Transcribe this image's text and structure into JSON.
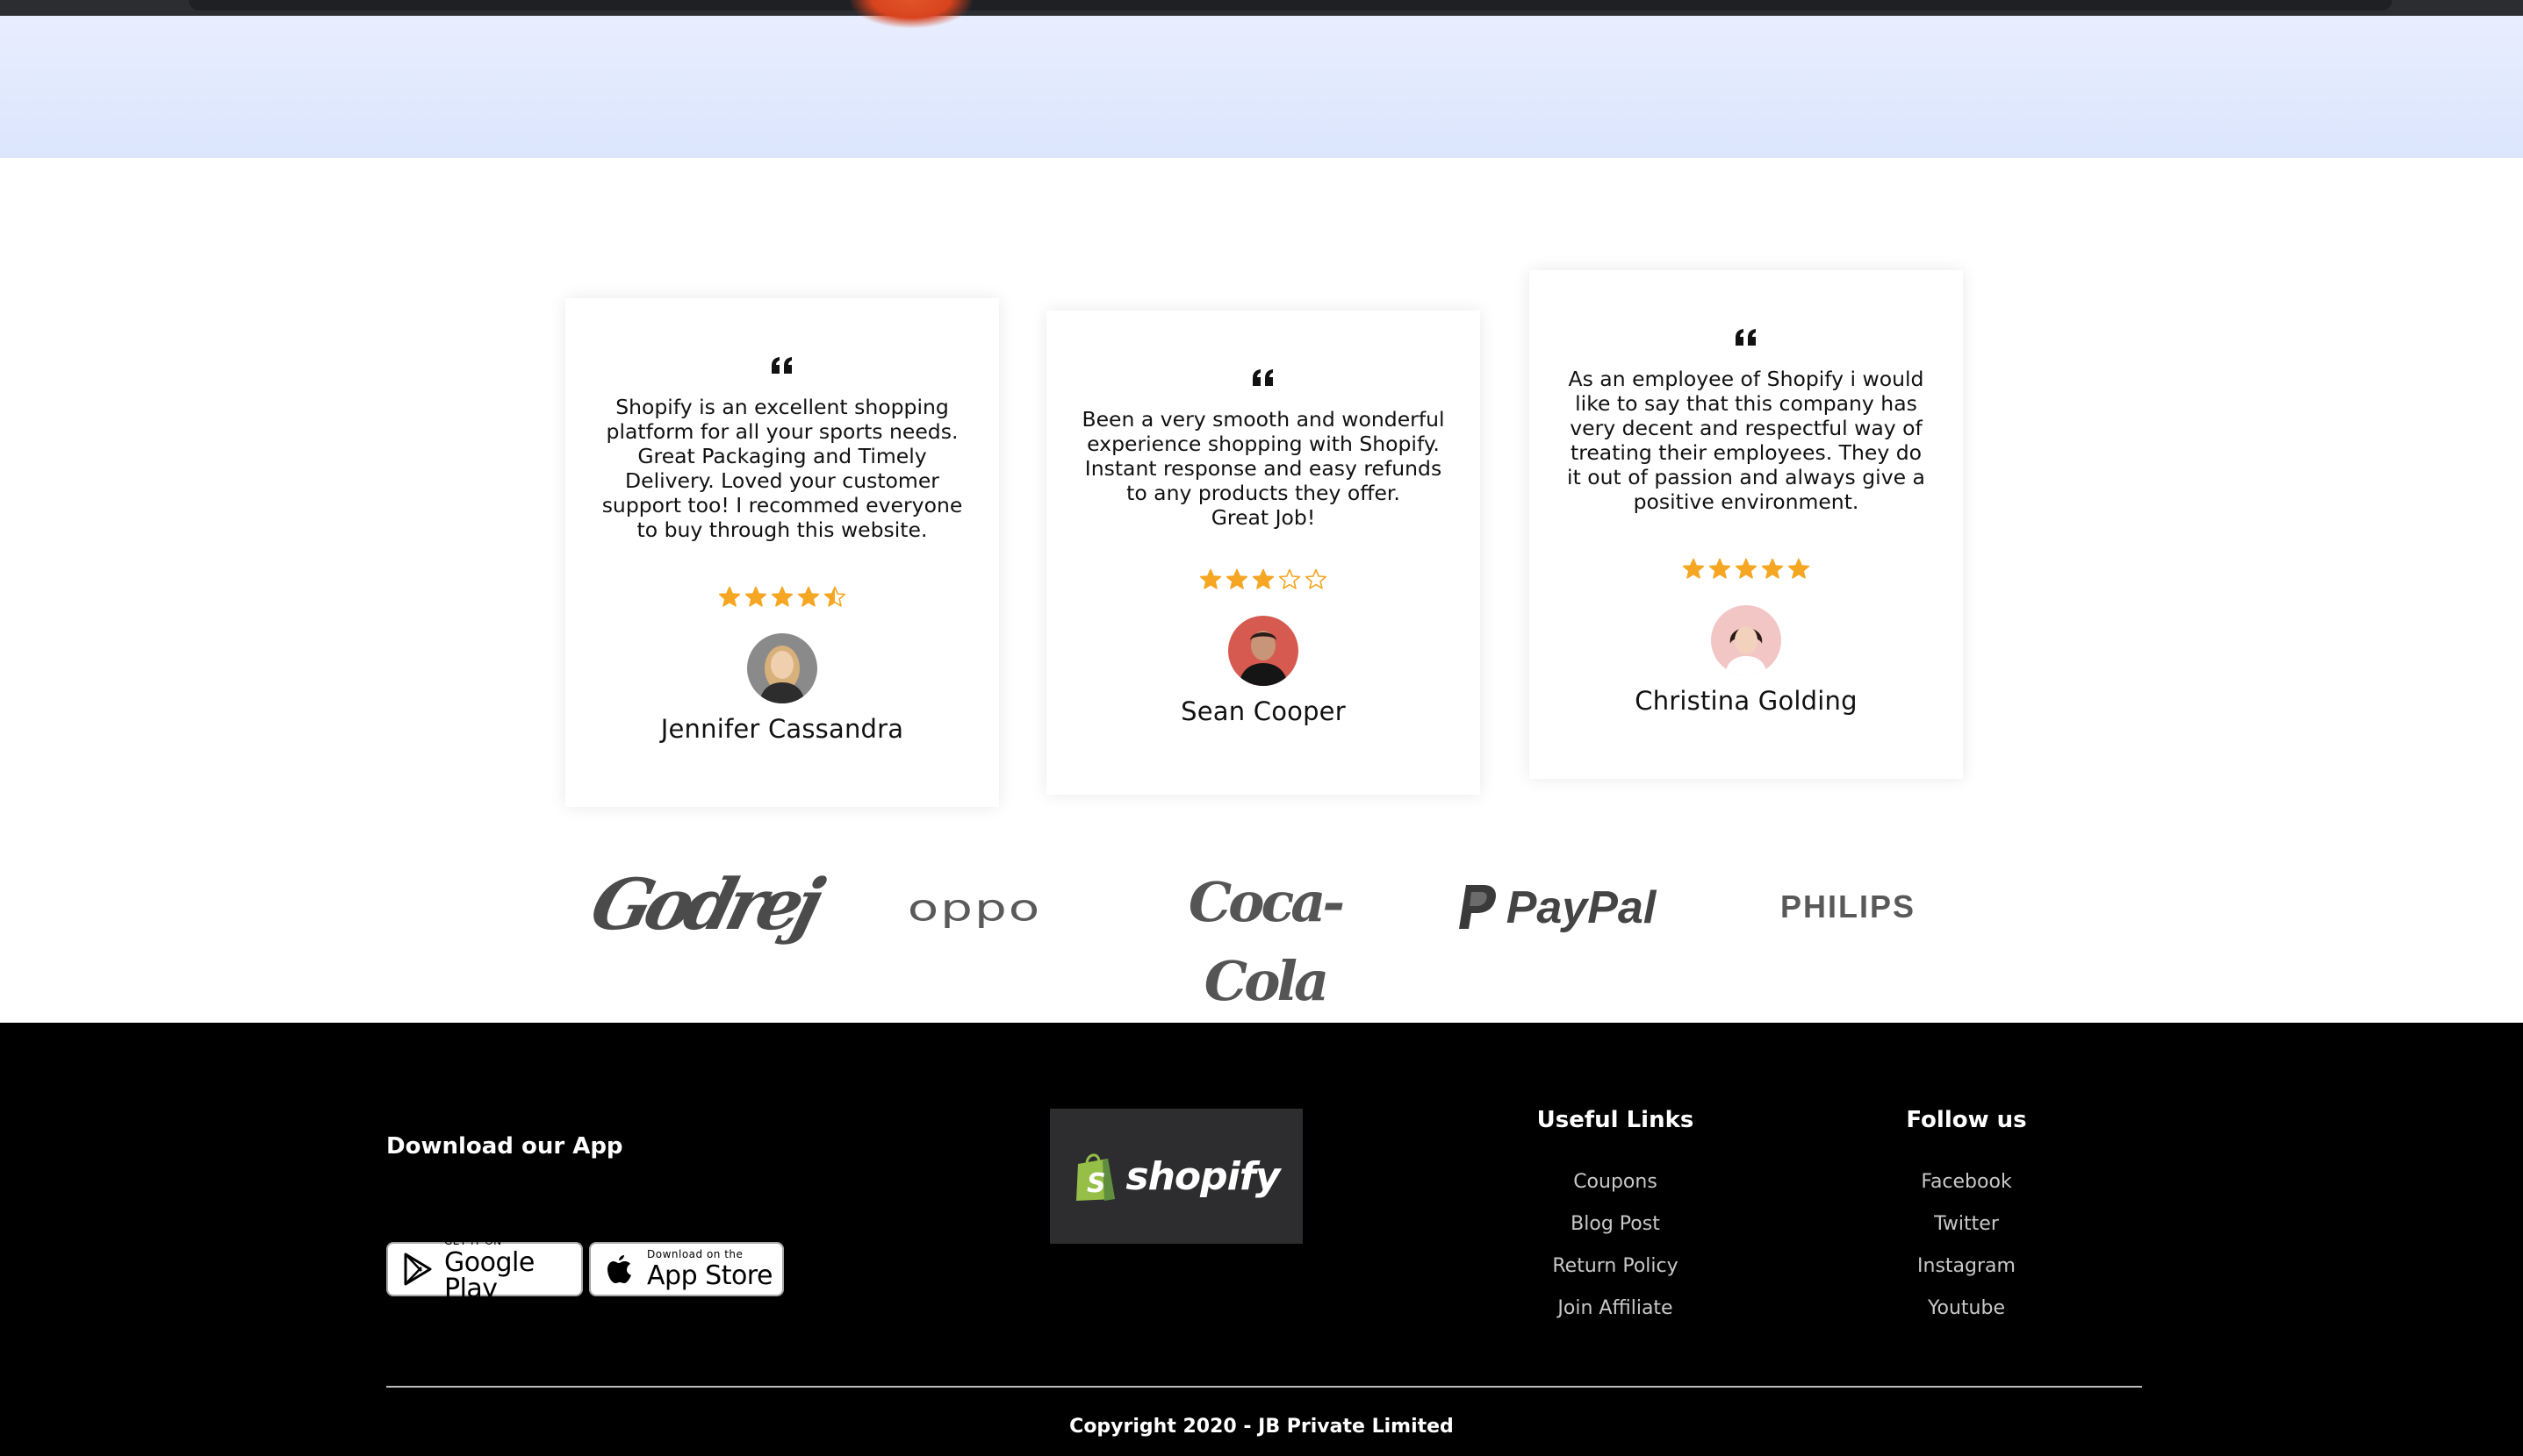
{
  "testimonials": [
    {
      "text": "Shopify is an excellent shopping platform for all your sports needs. Great Packaging and Timely Delivery. Loved your customer support too! I recommed everyone to buy through this website.",
      "rating": 4.5,
      "name": "Jennifer Cassandra"
    },
    {
      "text": "Been a very smooth and wonderful experience shopping with Shopify. Instant response and easy refunds to any products they offer.\nGreat Job!",
      "rating": 3,
      "name": "Sean Cooper"
    },
    {
      "text": "As an employee of Shopify i would like to say that this company has very decent and respectful way of treating their employees. They do it out of passion and always give a positive environment.",
      "rating": 5,
      "name": "Christina Golding"
    }
  ],
  "brands": [
    "Godrej",
    "oppo",
    "Coca-Cola",
    "PayPal",
    "PHILIPS"
  ],
  "footer": {
    "download_title": "Download our App",
    "google_play": {
      "small": "GET IT ON",
      "big": "Google Play"
    },
    "app_store": {
      "small": "Download on the",
      "big": "App Store"
    },
    "logo_text": "shopify",
    "useful_links_title": "Useful Links",
    "useful_links": [
      "Coupons",
      "Blog Post",
      "Return Policy",
      "Join Affiliate"
    ],
    "follow_title": "Follow us",
    "follow_links": [
      "Facebook",
      "Twitter",
      "Instagram",
      "Youtube"
    ],
    "copyright": "Copyright 2020 - JB Private Limited"
  },
  "colors": {
    "star": "#f5a623",
    "footer_bg": "#000000",
    "shopify_green": "#95bf47"
  }
}
